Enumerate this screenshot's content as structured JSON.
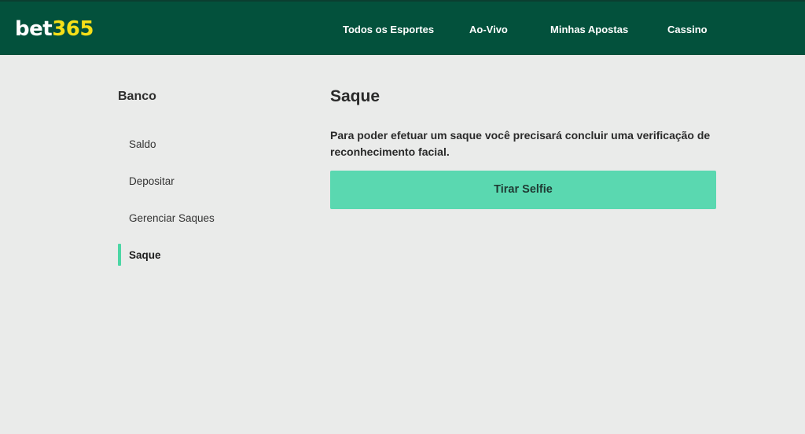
{
  "header": {
    "logo": {
      "part1": "bet",
      "part2": "365"
    },
    "nav": [
      {
        "label": "Todos os Esportes"
      },
      {
        "label": "Ao-Vivo"
      },
      {
        "label": "Minhas Apostas"
      },
      {
        "label": "Cassino"
      }
    ]
  },
  "sidebar": {
    "heading": "Banco",
    "items": [
      {
        "label": "Saldo",
        "active": false
      },
      {
        "label": "Depositar",
        "active": false
      },
      {
        "label": "Gerenciar Saques",
        "active": false
      },
      {
        "label": "Saque",
        "active": true
      }
    ]
  },
  "main": {
    "title": "Saque",
    "message": "Para poder efetuar um saque você precisará concluir uma verificação de reconhecimento facial.",
    "button_label": "Tirar Selfie"
  },
  "colors": {
    "header_bg": "#03513c",
    "logo_accent": "#f6df18",
    "button_bg": "#5ad8b0",
    "active_indicator": "#4cd6a5",
    "page_bg": "#eaebea"
  }
}
